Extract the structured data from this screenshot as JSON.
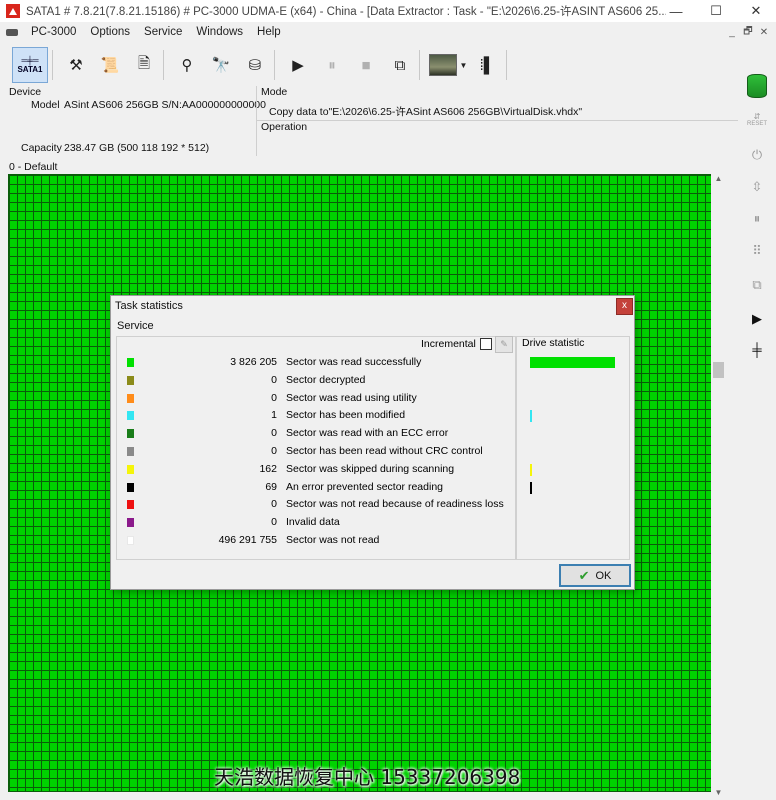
{
  "window": {
    "title": "SATA1 # 7.8.21(7.8.21.15186) # PC-3000 UDMA-E (x64) - China - [Data Extractor : Task - \"E:\\2026\\6.25-许ASINT AS606 25...",
    "controls": {
      "minimize": "—",
      "maximize": "☐",
      "close": "✕"
    }
  },
  "menu": {
    "items": [
      "PC-3000",
      "Options",
      "Service",
      "Windows",
      "Help"
    ],
    "mdi_controls": [
      "_",
      "🗗",
      "✕"
    ]
  },
  "toolbar": {
    "sata_label": "SATA1",
    "buttons": [
      {
        "icon": "tools-icon",
        "glyph": "⚒"
      },
      {
        "icon": "script-icon",
        "glyph": "📜"
      },
      {
        "icon": "sector-editor-icon",
        "glyph": "🗎"
      },
      {
        "icon": "tree-icon",
        "glyph": "⚲"
      },
      {
        "icon": "binoculars-icon",
        "glyph": "🔭"
      },
      {
        "icon": "disk-icon",
        "glyph": "⛁"
      },
      {
        "icon": "play-icon",
        "glyph": "▶"
      },
      {
        "icon": "pause-icon",
        "glyph": "⏸"
      },
      {
        "icon": "stop-icon",
        "glyph": "■"
      },
      {
        "icon": "copy-icon",
        "glyph": "⧉"
      }
    ]
  },
  "device": {
    "section_label": "Device",
    "model_label": "Model",
    "model_value": "ASint AS606 256GB  S/N:AA000000000000",
    "capacity_label": "Capacity",
    "capacity_value": "238.47 GB (500 118 192 * 512)"
  },
  "mode": {
    "section_label": "Mode",
    "value": "Copy data to\"E:\\2026\\6.25-许ASint AS606 256GB\\VirtualDisk.vhdx\"",
    "operation_label": "Operation"
  },
  "map": {
    "tab_label": "0 - Default",
    "fill_color": "#00d200"
  },
  "dialog": {
    "title": "Task statistics",
    "close_label": "x",
    "section": "Service",
    "incremental_label": "Incremental",
    "incremental_checked": false,
    "drive_statistic_label": "Drive statistic",
    "ok_label": "OK",
    "rows": [
      {
        "color": "#00e000",
        "count": "3 826 205",
        "label": "Sector was read successfully"
      },
      {
        "color": "#8b8b1a",
        "count": "0",
        "label": "Sector decrypted"
      },
      {
        "color": "#ff8c1a",
        "count": "0",
        "label": "Sector was read using utility"
      },
      {
        "color": "#33e6f2",
        "count": "1",
        "label": "Sector has been modified"
      },
      {
        "color": "#1a7d1a",
        "count": "0",
        "label": "Sector was read with an ECC error"
      },
      {
        "color": "#8a8a8a",
        "count": "0",
        "label": "Sector has been read without CRC control"
      },
      {
        "color": "#f5f50a",
        "count": "162",
        "label": "Sector was skipped during scanning"
      },
      {
        "color": "#000000",
        "count": "69",
        "label": "An error prevented sector reading"
      },
      {
        "color": "#ee1111",
        "count": "0",
        "label": "Sector was not read because of readiness loss"
      },
      {
        "color": "#8b1a8b",
        "count": "0",
        "label": "Invalid data"
      },
      {
        "color": "#ffffff",
        "count": "496 291 755",
        "label": "Sector was not read"
      }
    ]
  },
  "watermark": "天浩数据恢复中心  15337206398"
}
